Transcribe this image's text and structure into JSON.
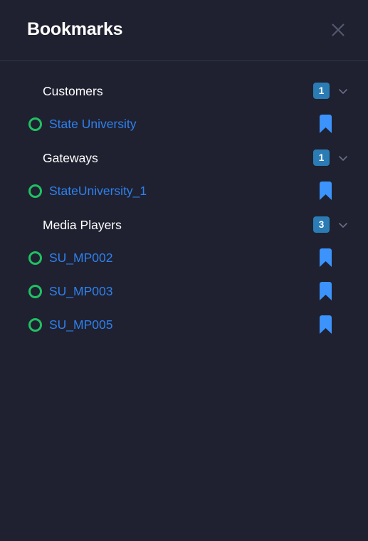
{
  "header": {
    "title": "Bookmarks",
    "close_icon": "close-icon"
  },
  "colors": {
    "background": "#1f2130",
    "divider": "#32364a",
    "title_text": "#ffffff",
    "link_text": "#2f80ed",
    "badge_bg": "#2b7cb5",
    "badge_text": "#ffffff",
    "status_ring": "#21c063",
    "bookmark_fill": "#3b93fb",
    "chevron": "#6a6f86",
    "close_icon": "#565a70"
  },
  "tree": {
    "groups": [
      {
        "label": "Customers",
        "count": "1",
        "chevron_icon": "chevron-down-icon",
        "items": [
          {
            "label": "State University",
            "status_icon": "status-online-icon",
            "bookmark_icon": "bookmark-filled-icon"
          }
        ]
      },
      {
        "label": "Gateways",
        "count": "1",
        "chevron_icon": "chevron-down-icon",
        "items": [
          {
            "label": "StateUniversity_1",
            "status_icon": "status-online-icon",
            "bookmark_icon": "bookmark-filled-icon"
          }
        ]
      },
      {
        "label": "Media Players",
        "count": "3",
        "chevron_icon": "chevron-down-icon",
        "items": [
          {
            "label": "SU_MP002",
            "status_icon": "status-online-icon",
            "bookmark_icon": "bookmark-filled-icon"
          },
          {
            "label": "SU_MP003",
            "status_icon": "status-online-icon",
            "bookmark_icon": "bookmark-filled-icon"
          },
          {
            "label": "SU_MP005",
            "status_icon": "status-online-icon",
            "bookmark_icon": "bookmark-filled-icon"
          }
        ]
      }
    ]
  }
}
